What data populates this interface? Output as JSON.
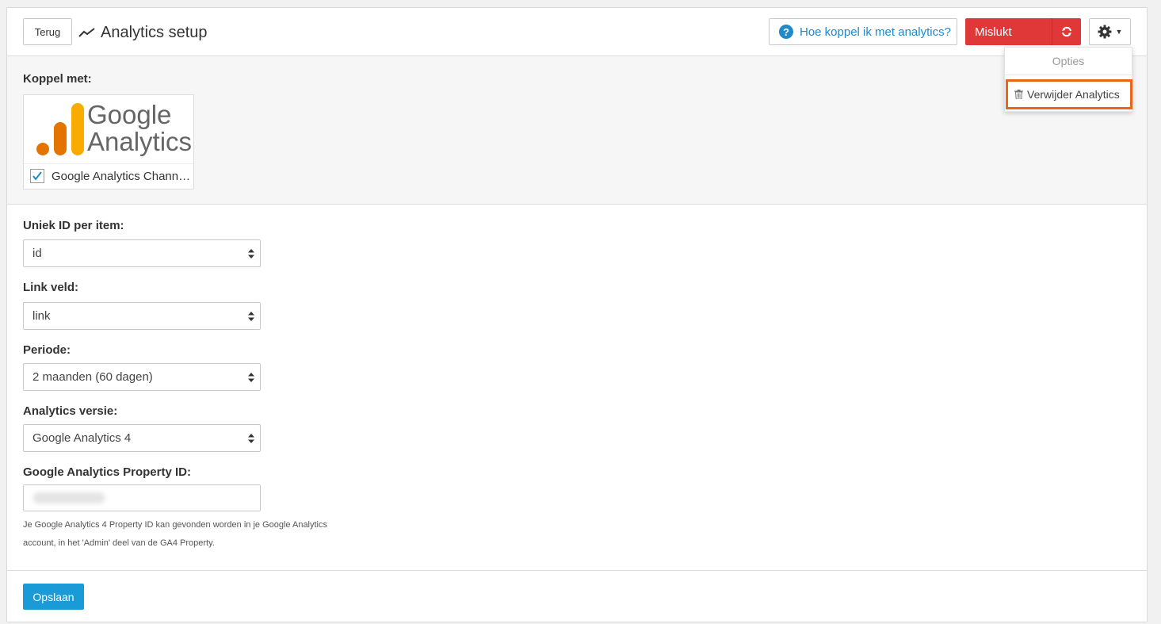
{
  "header": {
    "back_label": "Terug",
    "title": "Analytics setup",
    "help_label": "Hoe koppel ik met analytics?",
    "status_label": "Mislukt",
    "status_color": "#e03838"
  },
  "options_menu": {
    "header": "Opties",
    "items": [
      {
        "label": "Verwijder Analytics",
        "icon": "trash-icon"
      }
    ]
  },
  "koppel": {
    "label": "Koppel met:",
    "card": {
      "logo_text_line1": "Google",
      "logo_text_line2": "Analytics",
      "checkbox_label": "Google Analytics Channa…",
      "checked": true
    }
  },
  "form": {
    "unique_id": {
      "label": "Uniek ID per item:",
      "value": "id"
    },
    "link_field": {
      "label": "Link veld:",
      "value": "link"
    },
    "period": {
      "label": "Periode:",
      "value": "2 maanden (60 dagen)"
    },
    "version": {
      "label": "Analytics versie:",
      "value": "Google Analytics 4"
    },
    "property_id": {
      "label": "Google Analytics Property ID:",
      "help_line1": "Je Google Analytics 4 Property ID kan gevonden worden in je Google Analytics",
      "help_line2": "account, in het 'Admin' deel van de GA4 Property."
    }
  },
  "footer": {
    "save_label": "Opslaan"
  },
  "colors": {
    "accent": "#1a9ad6",
    "link": "#1f89c9",
    "danger": "#e03838",
    "highlight": "#e8661c"
  }
}
